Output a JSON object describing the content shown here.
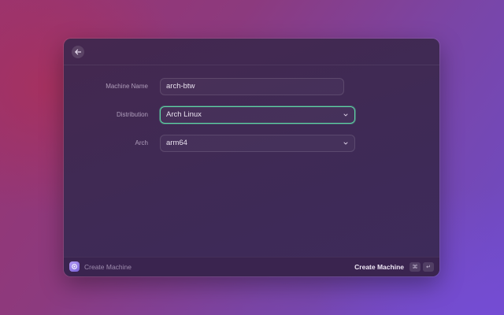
{
  "window": {
    "back_icon": "arrow-left-icon"
  },
  "form": {
    "machine_name": {
      "label": "Machine Name",
      "value": "arch-btw",
      "placeholder": ""
    },
    "distribution": {
      "label": "Distribution",
      "value": "Arch Linux"
    },
    "arch": {
      "label": "Arch",
      "value": "arm64"
    }
  },
  "footer": {
    "app_icon": "orbstack-icon",
    "title": "Create Machine",
    "primary_action": "Create Machine",
    "shortcut_cmd": "⌘",
    "shortcut_enter": "↵"
  },
  "colors": {
    "focus_ring": "#5fd6a6",
    "window_bg": "#3f2a55"
  }
}
